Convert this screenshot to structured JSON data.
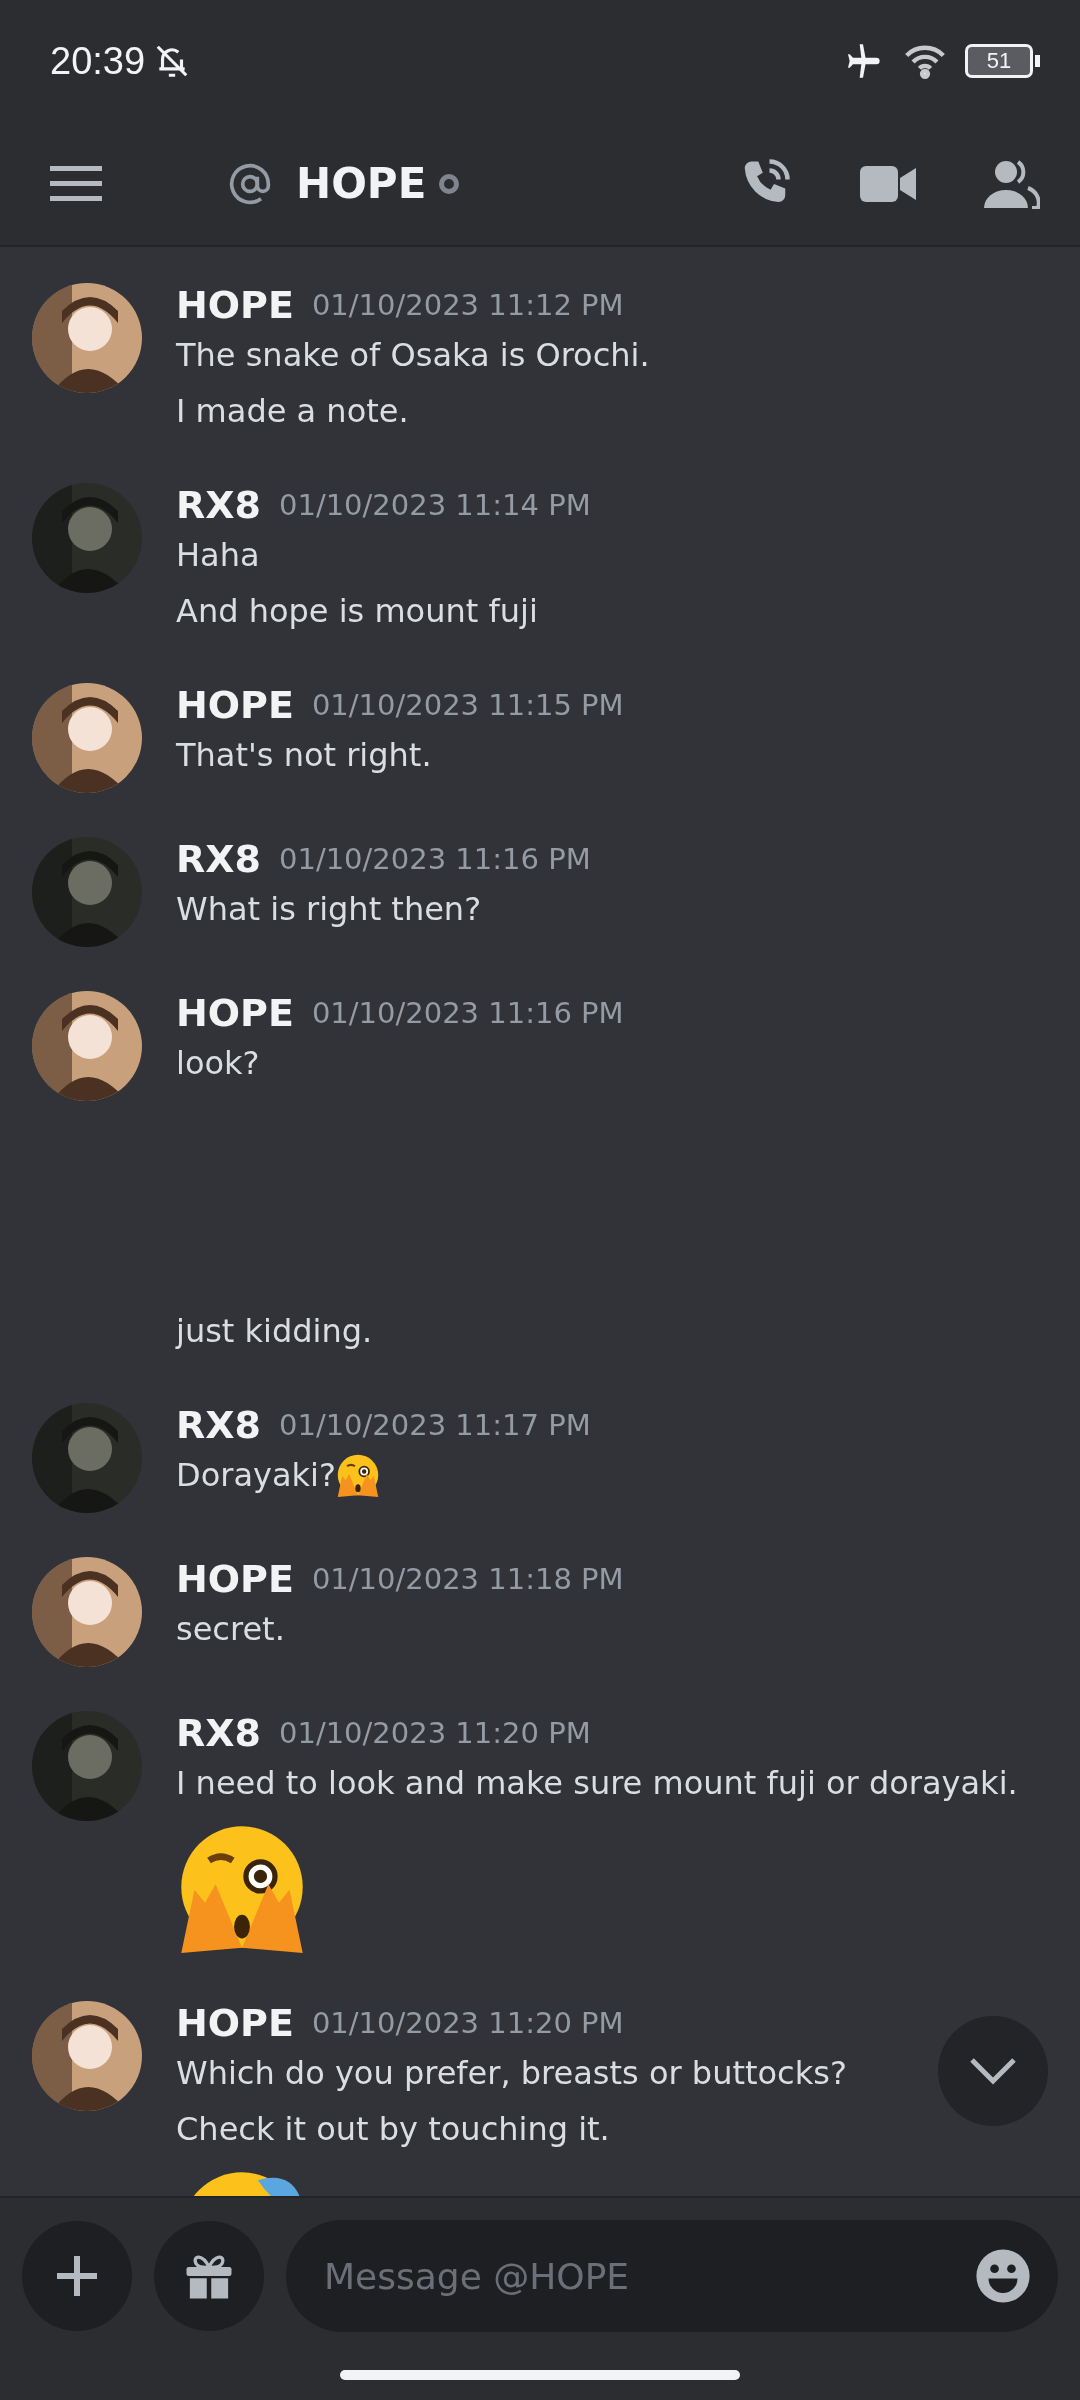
{
  "status_bar": {
    "time": "20:39",
    "battery": "51"
  },
  "header": {
    "title": "HOPE"
  },
  "messages": [
    {
      "author": "HOPE",
      "time": "01/10/2023 11:12 PM",
      "lines": [
        {
          "kind": "text",
          "text": "The snake of Osaka is Orochi."
        },
        {
          "kind": "text",
          "text": "I made a note."
        }
      ]
    },
    {
      "author": "RX8",
      "time": "01/10/2023 11:14 PM",
      "lines": [
        {
          "kind": "text",
          "text": "Haha"
        },
        {
          "kind": "text",
          "text": "And hope is mount fuji"
        }
      ]
    },
    {
      "author": "HOPE",
      "time": "01/10/2023 11:15 PM",
      "lines": [
        {
          "kind": "text",
          "text": "That's not right."
        }
      ]
    },
    {
      "author": "RX8",
      "time": "01/10/2023 11:16 PM",
      "lines": [
        {
          "kind": "text",
          "text": "What is right then?"
        }
      ]
    },
    {
      "author": "HOPE",
      "time": "01/10/2023 11:16 PM",
      "lines": [
        {
          "kind": "text",
          "text": "look?"
        },
        {
          "kind": "blank"
        },
        {
          "kind": "blank"
        },
        {
          "kind": "text",
          "text": "just kidding."
        }
      ]
    },
    {
      "author": "RX8",
      "time": "01/10/2023 11:17 PM",
      "lines": [
        {
          "kind": "text",
          "text": "Dorayaki?",
          "emoji": true
        }
      ]
    },
    {
      "author": "HOPE",
      "time": "01/10/2023 11:18 PM",
      "lines": [
        {
          "kind": "text",
          "text": "secret."
        }
      ]
    },
    {
      "author": "RX8",
      "time": "01/10/2023 11:20 PM",
      "lines": [
        {
          "kind": "text",
          "text": "I need to look and make sure mount fuji or dorayaki."
        },
        {
          "kind": "emoji"
        }
      ]
    },
    {
      "author": "HOPE",
      "time": "01/10/2023 11:20 PM",
      "lines": [
        {
          "kind": "text",
          "text": "Which do you prefer, breasts or buttocks?"
        },
        {
          "kind": "text",
          "text": "Check it out by touching it."
        },
        {
          "kind": "emoji"
        }
      ]
    }
  ],
  "composer": {
    "placeholder": "Message @HOPE"
  }
}
